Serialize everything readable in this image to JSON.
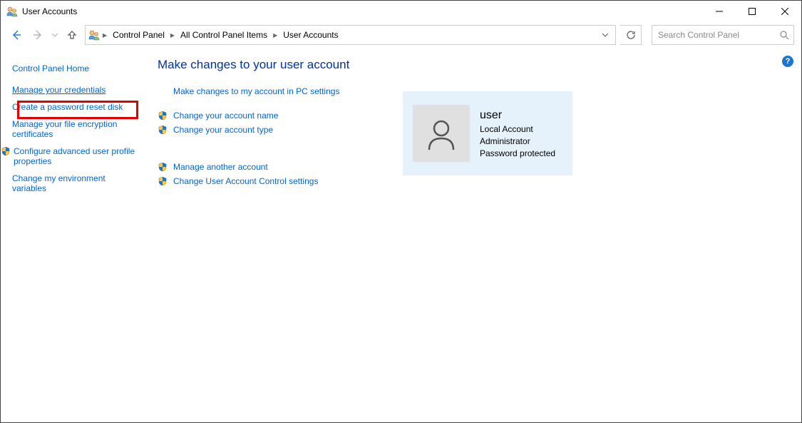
{
  "window": {
    "title": "User Accounts"
  },
  "breadcrumb": {
    "items": [
      "Control Panel",
      "All Control Panel Items",
      "User Accounts"
    ]
  },
  "search": {
    "placeholder": "Search Control Panel"
  },
  "sidebar": {
    "home": "Control Panel Home",
    "items": [
      {
        "label": "Manage your credentials",
        "shield": false
      },
      {
        "label": "Create a password reset disk",
        "shield": false,
        "highlighted": true
      },
      {
        "label": "Manage your file encryption certificates",
        "shield": false
      },
      {
        "label": "Configure advanced user profile properties",
        "shield": true
      },
      {
        "label": "Change my environment variables",
        "shield": false
      }
    ]
  },
  "main": {
    "heading": "Make changes to your user account",
    "links": [
      {
        "label": "Make changes to my account in PC settings",
        "shield": false
      },
      {
        "label": "Change your account name",
        "shield": true
      },
      {
        "label": "Change your account type",
        "shield": true
      }
    ],
    "links2": [
      {
        "label": "Manage another account",
        "shield": true
      },
      {
        "label": "Change User Account Control settings",
        "shield": true
      }
    ]
  },
  "user": {
    "name": "user",
    "type": "Local Account",
    "role": "Administrator",
    "protection": "Password protected"
  }
}
